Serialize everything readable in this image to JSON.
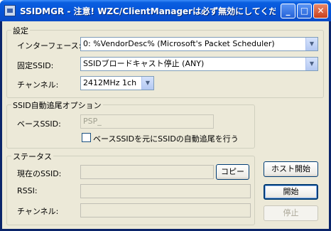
{
  "window": {
    "title": "SSIDMGR - 注意! WZC/ClientManagerは必ず無効にしてくだ...",
    "min_label": "_",
    "max_label": "□",
    "close_label": "✕"
  },
  "settings": {
    "legend": "設定",
    "interface_label": "インターフェース:",
    "interface_value": "0: %VendorDesc% (Microsoft's Packet Scheduler)",
    "fixed_ssid_label": "固定SSID:",
    "fixed_ssid_value": "SSIDブロードキャスト停止 (ANY)",
    "channel_label": "チャンネル:",
    "channel_value": "2412MHz  1ch"
  },
  "auto_track": {
    "legend": "SSID自動追尾オプション",
    "base_ssid_label": "ベースSSID:",
    "base_ssid_value": "PSP_",
    "checkbox_label": "ベースSSIDを元にSSIDの自動追尾を行う"
  },
  "status": {
    "legend": "ステータス",
    "current_ssid_label": "現在のSSID:",
    "current_ssid_value": "",
    "copy_button": "コピー",
    "rssi_label": "RSSI:",
    "rssi_value": "",
    "channel_label": "チャンネル:",
    "channel_value": ""
  },
  "actions": {
    "host_start": "ホスト開始",
    "start": "開始",
    "stop": "停止"
  }
}
